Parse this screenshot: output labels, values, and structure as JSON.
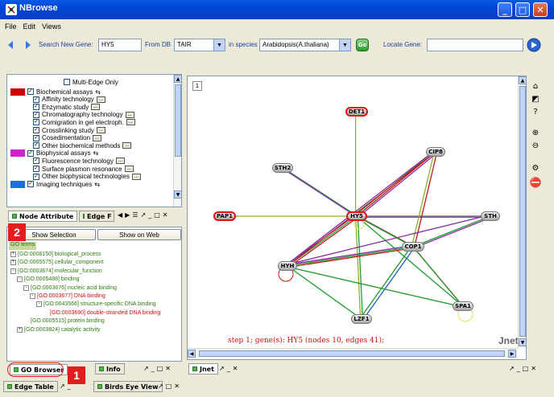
{
  "window": {
    "title": "NBrowse"
  },
  "menu": [
    "File",
    "Edit",
    "Views"
  ],
  "toolbar": {
    "search_label": "Search New Gene:",
    "search_value": "HY5",
    "from_db_label": "From DB",
    "db_value": "TAIR",
    "species_label": "in species",
    "species_value": "Arabidopsis(A.thaliana)",
    "go_button": "Go",
    "locate_label": "Locate Gene:",
    "locate_value": ""
  },
  "attributes": {
    "multi_edge": "Multi-Edge Only",
    "items": [
      {
        "label": "Biochemical assays",
        "level": 0,
        "color": "#c80000",
        "arrows": true
      },
      {
        "label": "Affinity technology",
        "level": 1
      },
      {
        "label": "Enzymatic study",
        "level": 1
      },
      {
        "label": "Chromatography technology",
        "level": 1
      },
      {
        "label": "Comigration in gel electroph.",
        "level": 1
      },
      {
        "label": "Crosslinking study",
        "level": 1
      },
      {
        "label": "Cosedimentation",
        "level": 1
      },
      {
        "label": "Other biochemical methods",
        "level": 1
      },
      {
        "label": "Biophysical assays",
        "level": 0,
        "color": "#d020d0",
        "arrows": true
      },
      {
        "label": "Fluorescence technology",
        "level": 1
      },
      {
        "label": "Surface plasmon resonance",
        "level": 1
      },
      {
        "label": "Other biophysical technologies",
        "level": 1
      },
      {
        "label": "Imaging techniques",
        "level": 0,
        "color": "#1e6fd8",
        "arrows": true
      }
    ],
    "dots_label": "...",
    "tabs": {
      "node_attribute": "Node Attribute",
      "edge": "Edge F"
    }
  },
  "go_panel": {
    "show_selection": "Show Selection",
    "show_on_web": "Show on Web",
    "header": "GO terms",
    "terms": [
      {
        "label": "[GO:0008150] biological_process",
        "level": 0,
        "red": false,
        "tog": "+"
      },
      {
        "label": "[GO:0005575] cellular_component",
        "level": 0,
        "red": false,
        "tog": "+"
      },
      {
        "label": "[GO:0003674] molecular_function",
        "level": 0,
        "red": false,
        "tog": "-"
      },
      {
        "label": "[GO:0005488] binding",
        "level": 1,
        "red": false,
        "tog": "-"
      },
      {
        "label": "[GO:0003676] nucleic acid binding",
        "level": 2,
        "red": false,
        "tog": "-"
      },
      {
        "label": "[GO:0003677] DNA binding",
        "level": 3,
        "red": true,
        "tog": "-"
      },
      {
        "label": "[GO:0043566] structure-specific DNA binding",
        "level": 4,
        "red": false,
        "tog": "-"
      },
      {
        "label": "[GO:0003690] double-stranded DNA binding",
        "level": 5,
        "red": true,
        "tog": ""
      },
      {
        "label": "[GO:0005515] protein binding",
        "level": 2,
        "red": false,
        "tog": ""
      },
      {
        "label": "[GO:0003824] catalytic activity",
        "level": 1,
        "red": false,
        "tog": "+"
      }
    ],
    "tabs": {
      "go_browser": "GO Browser",
      "info": "Info"
    }
  },
  "bottom_tabs": {
    "edge_table": "Edge Table",
    "birds_eye": "Birds Eye View"
  },
  "badges": {
    "one": "1",
    "two": "2"
  },
  "graph": {
    "page_number": "1",
    "status": "step 1; gene(s): HY5 (nodes 10, edges 41);",
    "watermark": "Jnet",
    "tab_label": "Jnet",
    "nodes": [
      {
        "id": "DET1",
        "label": "DET1",
        "hl": true
      },
      {
        "id": "CIP8",
        "label": "CIP8",
        "hl": false
      },
      {
        "id": "STH2",
        "label": "STH2",
        "hl": false
      },
      {
        "id": "PAP1",
        "label": "PAP1",
        "hl": true
      },
      {
        "id": "HY5",
        "label": "HY5",
        "hl": true
      },
      {
        "id": "STH",
        "label": "STH",
        "hl": false
      },
      {
        "id": "COP1",
        "label": "COP1",
        "hl": false
      },
      {
        "id": "HYH",
        "label": "HYH",
        "hl": false
      },
      {
        "id": "SPA1",
        "label": "SPA1",
        "hl": false
      },
      {
        "id": "LZF1",
        "label": "LZF1",
        "hl": false
      }
    ]
  },
  "colors": {
    "title_blue": "#0046d5",
    "go_green": "#2f7a12",
    "go_red": "#cc1010",
    "status_red": "#cc1010"
  }
}
